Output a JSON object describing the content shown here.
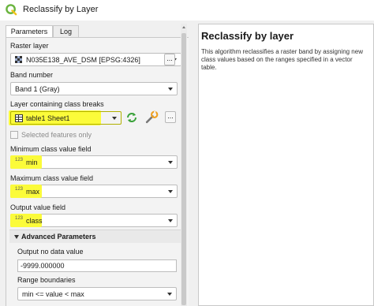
{
  "window": {
    "title": "Reclassify by Layer",
    "icon": "qgis-logo-icon"
  },
  "tabs": [
    {
      "label": "Parameters",
      "active": true
    },
    {
      "label": "Log",
      "active": false
    }
  ],
  "form": {
    "raster_layer_label": "Raster layer",
    "raster_layer_value": "N035E138_AVE_DSM [EPSG:4326]",
    "band_number_label": "Band number",
    "band_number_value": "Band 1 (Gray)",
    "class_breaks_label": "Layer containing class breaks",
    "class_breaks_value": "table1 Sheet1",
    "selected_only_label": "Selected features only",
    "min_field_label": "Minimum class value field",
    "min_field_value": "min",
    "max_field_label": "Maximum class value field",
    "max_field_value": "max",
    "output_field_label": "Output value field",
    "output_field_value": "class",
    "field_type_icon_text": "123",
    "ellipsis_label": "..."
  },
  "advanced": {
    "header_label": "Advanced Parameters",
    "nodata_label": "Output no data value",
    "nodata_value": "-9999.000000",
    "range_label": "Range boundaries",
    "range_value": "min <= value < max"
  },
  "help": {
    "title": "Reclassify by layer",
    "text": "This algorithm reclassifies a raster band by assigning new class values based on the ranges specified in a vector table."
  },
  "colors": {
    "highlight": "#fbfb3a",
    "qgis_green": "#6ab43e"
  }
}
